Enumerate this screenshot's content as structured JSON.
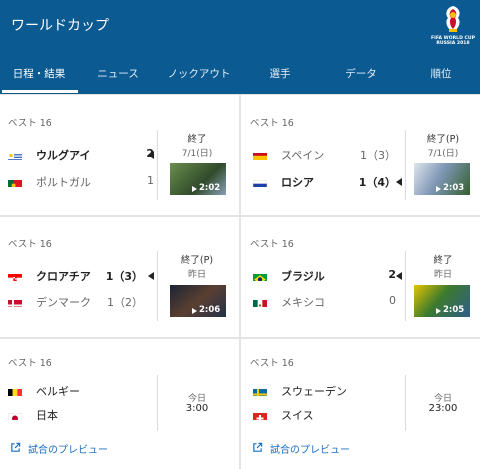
{
  "header": {
    "title": "ワールドカップ",
    "logo_text_1": "FIFA WORLD CUP",
    "logo_text_2": "RUSSIA 2018"
  },
  "tabs": [
    {
      "label": "日程・結果",
      "active": true
    },
    {
      "label": "ニュース"
    },
    {
      "label": "ノックアウト"
    },
    {
      "label": "選手"
    },
    {
      "label": "データ"
    },
    {
      "label": "順位"
    }
  ],
  "matches": [
    {
      "stage": "ベスト 16",
      "home": {
        "name": "ウルグアイ",
        "score": "2",
        "flag": "uruguay"
      },
      "away": {
        "name": "ポルトガル",
        "score": "1",
        "flag": "portugal"
      },
      "winner": "home",
      "status": "終了",
      "date": "7/1(日)",
      "video_duration": "2:02"
    },
    {
      "stage": "ベスト 16",
      "home": {
        "name": "スペイン",
        "score": "1（3）",
        "flag": "spain"
      },
      "away": {
        "name": "ロシア",
        "score": "1（4）",
        "flag": "russia"
      },
      "winner": "away",
      "status": "終了(P)",
      "date": "7/1(日)",
      "video_duration": "2:03"
    },
    {
      "stage": "ベスト 16",
      "home": {
        "name": "クロアチア",
        "score": "1（3）",
        "flag": "croatia"
      },
      "away": {
        "name": "デンマーク",
        "score": "1（2）",
        "flag": "denmark"
      },
      "winner": "home",
      "status": "終了(P)",
      "date": "昨日",
      "video_duration": "2:06"
    },
    {
      "stage": "ベスト 16",
      "home": {
        "name": "ブラジル",
        "score": "2",
        "flag": "brazil"
      },
      "away": {
        "name": "メキシコ",
        "score": "0",
        "flag": "mexico"
      },
      "winner": "home",
      "status": "終了",
      "date": "昨日",
      "video_duration": "2:05"
    },
    {
      "stage": "ベスト 16",
      "home": {
        "name": "ベルギー",
        "flag": "belgium"
      },
      "away": {
        "name": "日本",
        "flag": "japan"
      },
      "status": "今日",
      "time": "3:00",
      "preview_label": "試合のプレビュー"
    },
    {
      "stage": "ベスト 16",
      "home": {
        "name": "スウェーデン",
        "flag": "sweden"
      },
      "away": {
        "name": "スイス",
        "flag": "switzerland"
      },
      "status": "今日",
      "time": "23:00",
      "preview_label": "試合のプレビュー"
    }
  ],
  "colors": {
    "header_bg": "#0b5a92",
    "link": "#1a6fc2"
  },
  "icons": [
    "play-icon",
    "external-link-icon",
    "winner-arrow-icon",
    "world-cup-logo"
  ]
}
